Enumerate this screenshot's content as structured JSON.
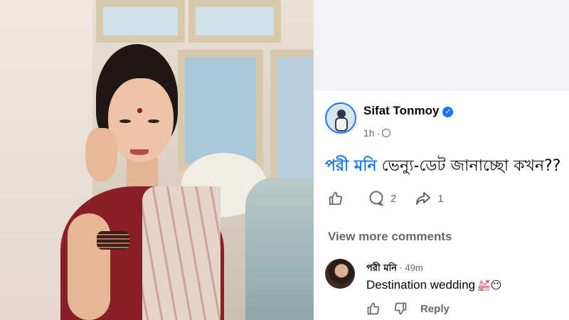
{
  "post": {
    "author": "Sifat Tonmoy",
    "time": "1h",
    "mention": "পরী মনি",
    "text": " ভেন্যু-ডেট জানাচ্ছো কখন??",
    "comment_count": "2",
    "share_count": "1"
  },
  "comments": {
    "view_more": "View more comments"
  },
  "reply": {
    "author": "পরী মনি",
    "time": " · 49m",
    "text": "Destination wedding",
    "emoji": "💒😶",
    "reply_label": "Reply"
  },
  "colors": {
    "accent": "#1877f2",
    "secondary_text": "#65676b",
    "background_gap": "#f0f2f5"
  },
  "icons": [
    "verified-badge-icon",
    "globe-icon",
    "like-icon",
    "comment-icon",
    "share-icon",
    "dislike-icon"
  ]
}
